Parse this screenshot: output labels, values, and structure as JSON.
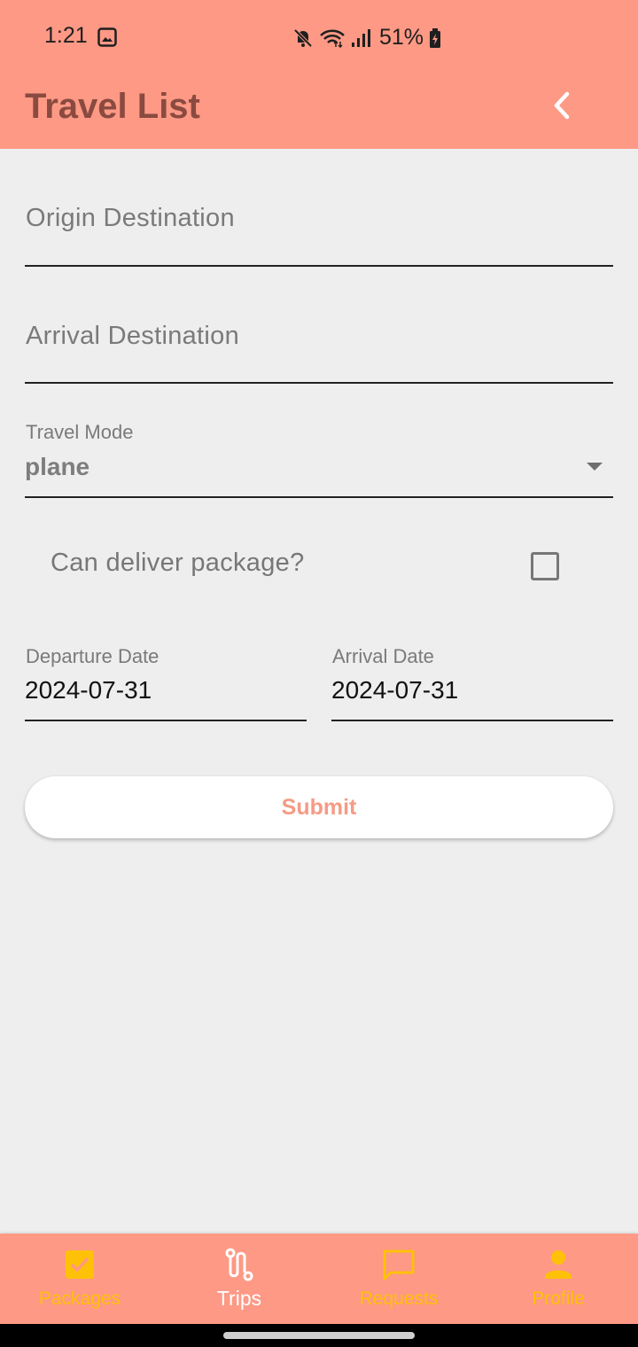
{
  "status_bar": {
    "time": "1:21",
    "battery": "51%",
    "icons": [
      "gallery-icon",
      "mute-icon",
      "wifi-icon",
      "signal-icon",
      "battery-icon"
    ]
  },
  "app_bar": {
    "title": "Travel List",
    "back_icon": "chevron-left-icon"
  },
  "form": {
    "origin": {
      "placeholder": "Origin Destination",
      "value": ""
    },
    "arrival": {
      "placeholder": "Arrival Destination",
      "value": ""
    },
    "travel_mode": {
      "label": "Travel Mode",
      "selected": "plane"
    },
    "deliver_package": {
      "label": "Can deliver package?",
      "checked": false
    },
    "departure_date": {
      "label": "Departure Date",
      "value": "2024-07-31"
    },
    "arrival_date": {
      "label": "Arrival Date",
      "value": "2024-07-31"
    },
    "submit_label": "Submit"
  },
  "bottom_nav": {
    "items": [
      {
        "label": "Packages",
        "icon": "checkbox-icon",
        "active": false
      },
      {
        "label": "Trips",
        "icon": "route-icon",
        "active": true
      },
      {
        "label": "Requests",
        "icon": "chat-icon",
        "active": false
      },
      {
        "label": "Profile",
        "icon": "person-icon",
        "active": false
      }
    ]
  },
  "colors": {
    "primary": "#fd9985",
    "title_text": "#8a4a40",
    "nav_inactive": "#ffc107",
    "nav_active": "#ffffff",
    "background": "#eeeeee"
  }
}
